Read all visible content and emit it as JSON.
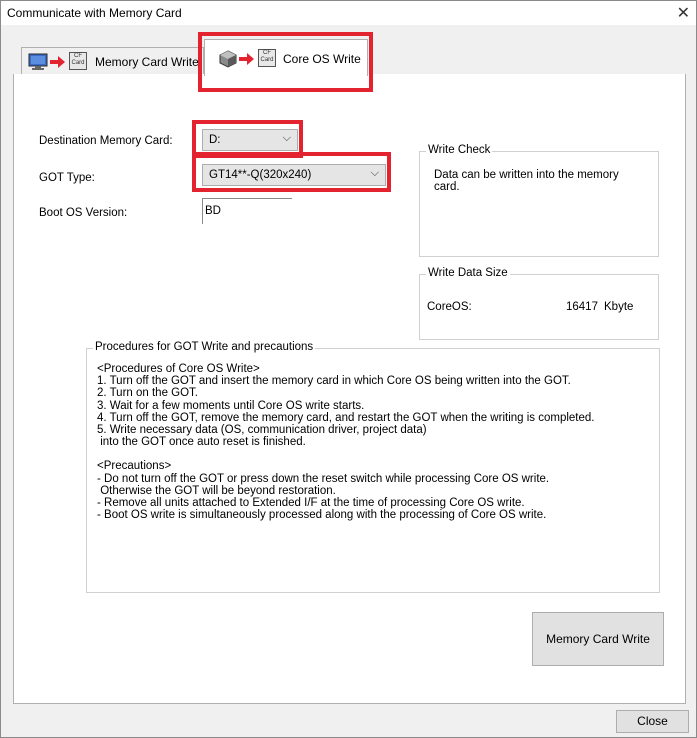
{
  "window": {
    "title": "Communicate with Memory Card"
  },
  "tabs": [
    {
      "label": "Memory Card Write"
    },
    {
      "label": "Core OS Write"
    }
  ],
  "icons": {
    "cf_card_text_top": "CF",
    "cf_card_text_bottom": "Card"
  },
  "form": {
    "destination_label": "Destination Memory Card:",
    "destination_value": "D:",
    "got_type_label": "GOT Type:",
    "got_type_value": "GT14**-Q(320x240)",
    "boot_os_label": "Boot OS Version:",
    "boot_os_value": "BD"
  },
  "write_check": {
    "title": "Write Check",
    "message_line1": "Data can be written into the memory",
    "message_line2": "card."
  },
  "write_size": {
    "title": "Write Data Size",
    "item_label": "CoreOS:",
    "value": "16417",
    "unit": "Kbyte"
  },
  "procedures": {
    "title": "Procedures for GOT Write and precautions",
    "lines": [
      "<Procedures of Core OS Write>",
      "1. Turn off the GOT and insert the memory card in which Core OS being written into the GOT.",
      "2. Turn on the GOT.",
      "3. Wait for a few moments until Core OS write starts.",
      "4. Turn off the GOT, remove the memory card, and restart the GOT when the writing is completed.",
      "5. Write necessary data (OS, communication driver, project data)",
      " into the GOT once auto reset is finished.",
      "",
      "<Precautions>",
      "- Do not turn off the GOT or press down the reset switch while processing Core OS write.",
      " Otherwise the GOT will be beyond restoration.",
      "- Remove all units attached to Extended I/F at the time of processing Core OS write.",
      "- Boot OS write is simultaneously processed along with the processing of Core OS write."
    ]
  },
  "buttons": {
    "write": "Memory Card Write",
    "close": "Close"
  },
  "colors": {
    "highlight": "#e3232f",
    "arrow": "#e3232f"
  }
}
